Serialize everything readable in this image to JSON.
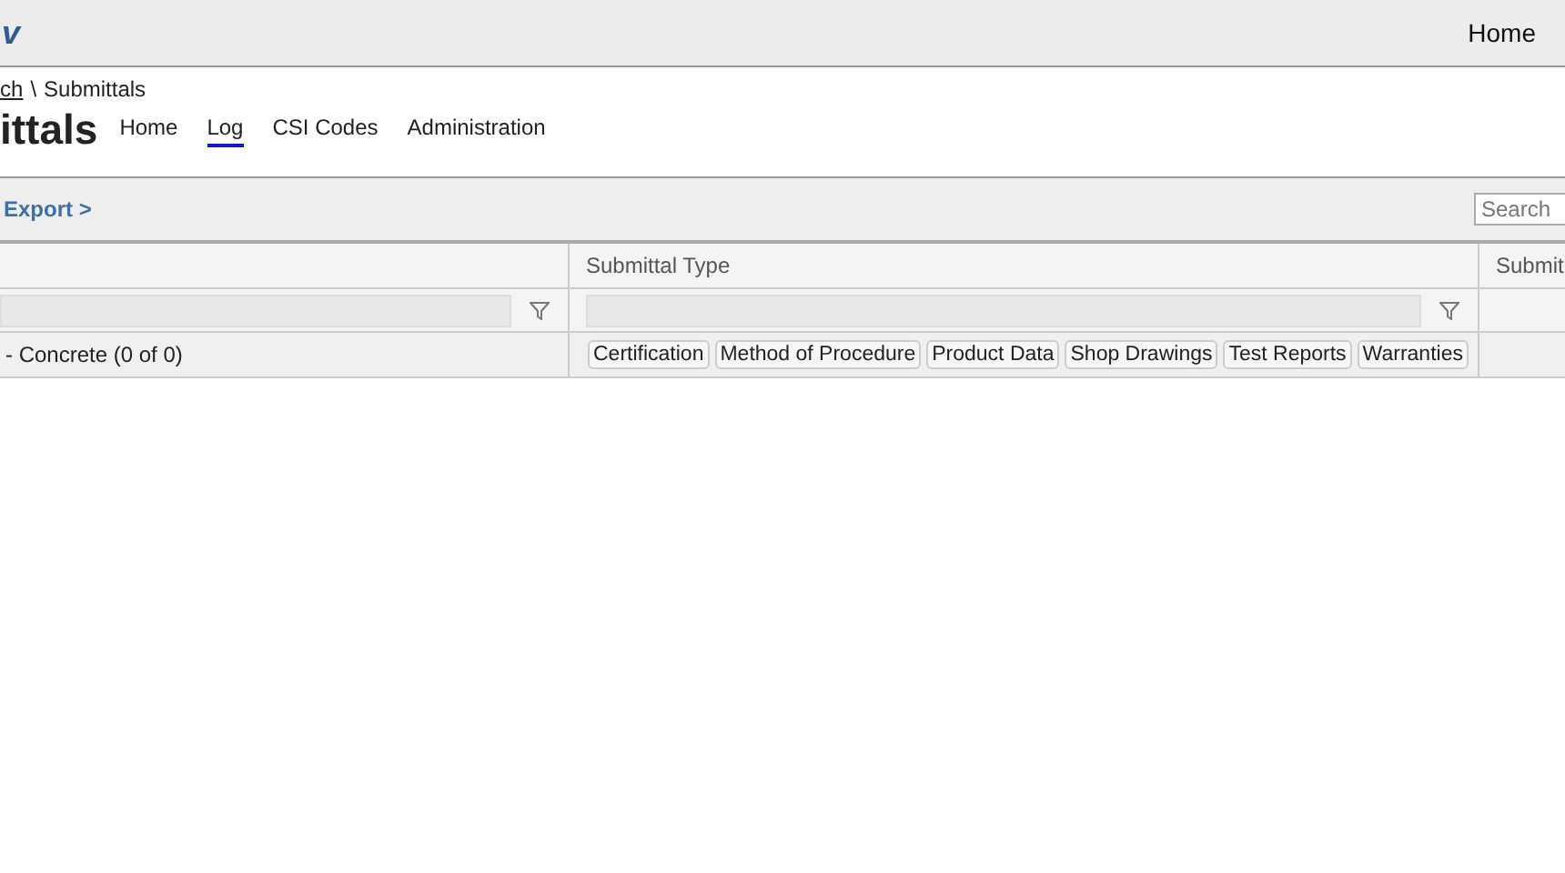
{
  "top_bar": {
    "logo": "v",
    "home_link": "Home"
  },
  "breadcrumb": {
    "link": "ch",
    "separator": "\\",
    "current": "Submittals"
  },
  "page_title": "ittals",
  "tabs": [
    {
      "label": "Home",
      "selected": false
    },
    {
      "label": "Log",
      "selected": true
    },
    {
      "label": "CSI Codes",
      "selected": false
    },
    {
      "label": "Administration",
      "selected": false
    }
  ],
  "toolbar": {
    "export_link": "Export >",
    "search": {
      "placeholder": "Search"
    }
  },
  "table": {
    "columns": [
      {},
      {
        "label": "Submittal Type"
      },
      {
        "label": "Submit"
      }
    ],
    "group_row": {
      "label": "- Concrete (0 of 0)",
      "tags": [
        "Certification",
        "Method of Procedure",
        "Product Data",
        "Shop Drawings",
        "Test Reports",
        "Warranties"
      ]
    }
  }
}
